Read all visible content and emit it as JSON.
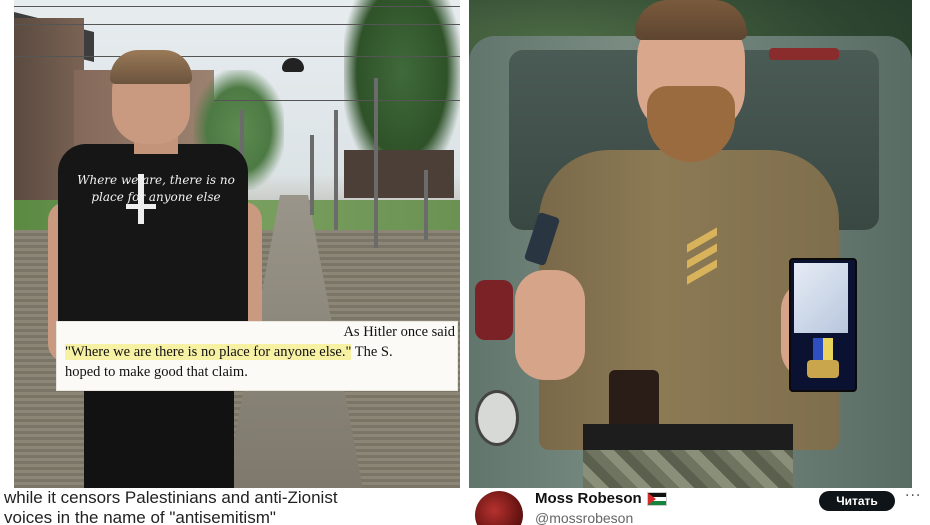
{
  "left_photo": {
    "shirt_text": "Where we are, there is no place for anyone else",
    "quote_line1": "As Hitler once said",
    "quote_highlight": "\"Where we are there is no place for anyone else.\"",
    "quote_line2_tail": " The S.",
    "quote_line3": "hoped to make good that claim."
  },
  "caption": {
    "line1": "while it censors Palestinians and anti-Zionist",
    "line2": "voices in the name of \"antisemitism\""
  },
  "tweet": {
    "name": "Moss Robeson",
    "handle": "@mossrobeson",
    "button_label": "Читать",
    "more_glyph": "···",
    "flag_icon": "palestine-flag-icon"
  }
}
